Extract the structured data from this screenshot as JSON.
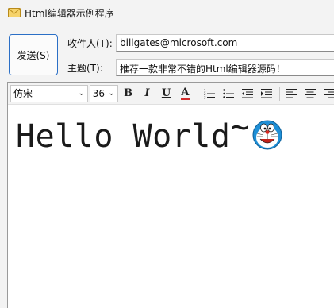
{
  "window": {
    "title": "Html编辑器示例程序"
  },
  "send_button": {
    "label": "发送(S)"
  },
  "fields": {
    "to_label": "收件人(T):",
    "to_value": "billgates@microsoft.com",
    "subject_label": "主题(T):",
    "subject_value": "推荐一款非常不错的Html编辑器源码！"
  },
  "toolbar": {
    "font_family": "仿宋",
    "font_size": "36",
    "bold_label": "B",
    "italic_label": "I",
    "underline_label": "U",
    "color_label": "A",
    "color_underline": "#d22b2b",
    "icons": [
      "bold-icon",
      "italic-icon",
      "underline-icon",
      "font-color-icon",
      "numbered-list-icon",
      "bullet-list-icon",
      "outdent-icon",
      "indent-icon",
      "align-left-icon",
      "align-center-icon",
      "align-right-icon"
    ]
  },
  "editor": {
    "text": "Hello World",
    "tilde": "~",
    "emoji": "doraemon-emoji"
  },
  "colors": {
    "accent": "#2b6fc6",
    "background": "#f3f3f3"
  }
}
